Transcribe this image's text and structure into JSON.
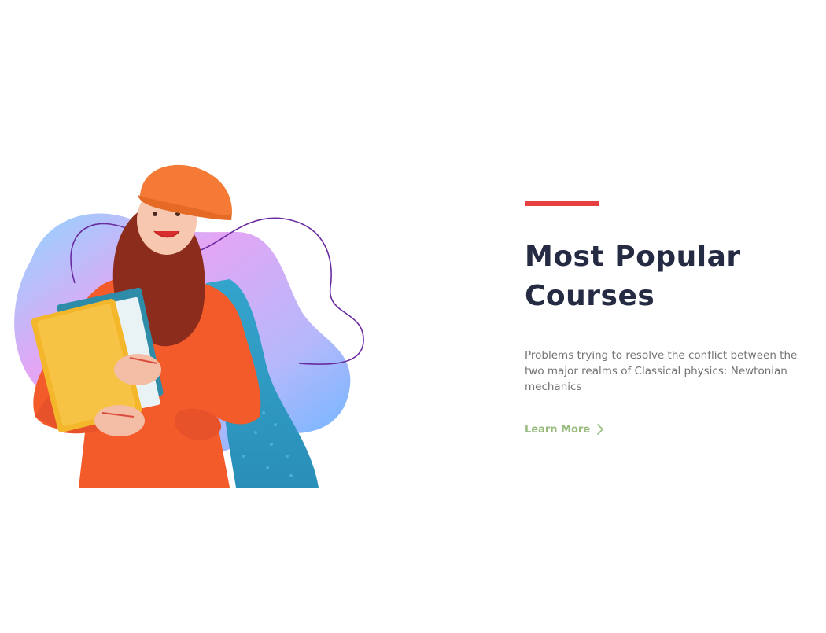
{
  "hero": {
    "image_description_icon": "student-with-books-illustration"
  },
  "section": {
    "title_line1": "Most Popular",
    "title_line2": "Courses",
    "description": "Problems trying to resolve the conflict between the two major realms of Classical physics: Newtonian mechanics",
    "cta_label": "Learn More",
    "cta_icon": "chevron-right-icon"
  },
  "colors": {
    "accent": "#e74040",
    "title": "#252b42",
    "text": "#737373",
    "cta": "#96bb7c"
  }
}
